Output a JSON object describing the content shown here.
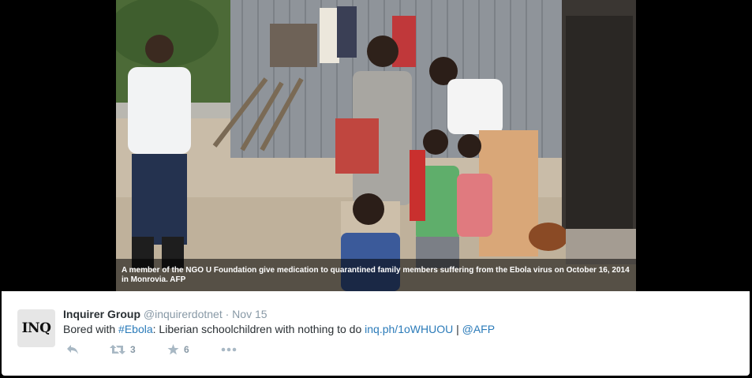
{
  "caption": "A member of the NGO U Foundation give medication to quarantined family members suffering from the Ebola virus on October 16, 2014 in Monrovia. AFP",
  "photo": {
    "subject": "members-outdoors-photo"
  },
  "tweet": {
    "avatar_text": "INQ",
    "author_name": "Inquirer Group",
    "handle": "@inquirerdotnet",
    "separator": "·",
    "timestamp": "Nov 15",
    "text_parts": {
      "prefix": "Bored with ",
      "hashtag": "#Ebola",
      "middle": ": Liberian schoolchildren with nothing to do ",
      "link": "inq.ph/1oWHUOU",
      "pipe": " | ",
      "mention": "@AFP"
    },
    "actions": {
      "retweets": "3",
      "favorites": "6"
    }
  },
  "colors": {
    "link": "#2b7bb9",
    "muted": "#8899a6",
    "text": "#292f33"
  }
}
